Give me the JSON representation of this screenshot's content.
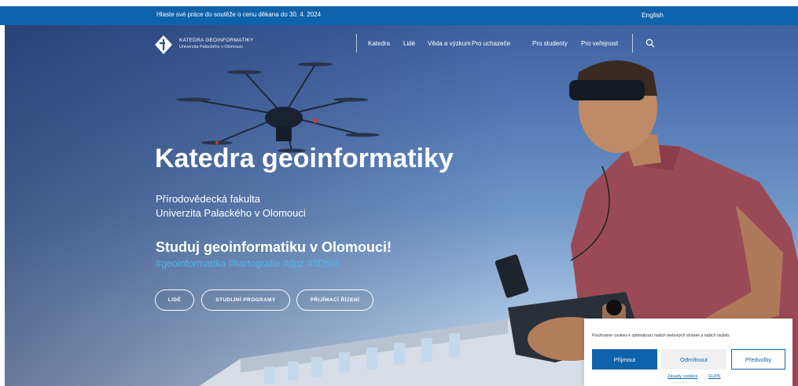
{
  "topbar": {
    "announcement": "Hlaste své práce do soutěže o cenu děkana do 30. 4. 2024",
    "language": "English"
  },
  "brand": {
    "line1": "KATEDRA GEOINFORMATIKY",
    "line2": "Univerzita Palackého v Olomouci"
  },
  "nav": {
    "items": [
      {
        "label": "Katedra"
      },
      {
        "label": "Lidé"
      },
      {
        "label": "Věda a výzkum"
      },
      {
        "label": "Pro uchazeče"
      },
      {
        "label": "Pro studenty"
      },
      {
        "label": "Pro veřejnost"
      }
    ],
    "search_icon": "search-icon"
  },
  "hero": {
    "title": "Katedra geoinformatiky",
    "subtitle_line1": "Přírodovědecká fakulta",
    "subtitle_line2": "Univerzita Palackého v Olomouci",
    "cta": "Studuj geoinformatiku v Olomouci!",
    "tags": "#geoinformatika #kartografie #dpz #3Dtisk",
    "buttons": [
      {
        "label": "LIDÉ"
      },
      {
        "label": "STUDIJNÍ PROGRAMY"
      },
      {
        "label": "PŘIJÍMACÍ ŘÍZENÍ"
      }
    ]
  },
  "cookie": {
    "message": "Používáme cookies k optimalizaci našich webových stránek a našich služeb.",
    "accept": "Přijmout",
    "reject": "Odmítnout",
    "preferences": "Předvolby",
    "link_policy": "Zásady cookies",
    "link_gdpr": "GUPK"
  },
  "colors": {
    "brand_blue": "#0f63aa",
    "tag_blue": "#4eb6ea",
    "sky": "#5276b3"
  }
}
